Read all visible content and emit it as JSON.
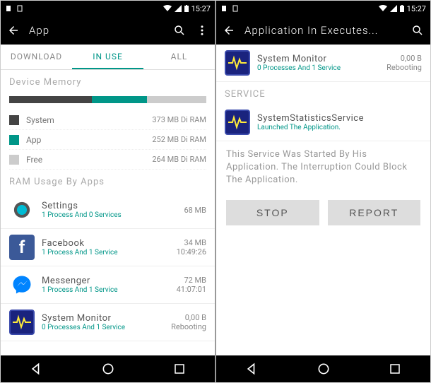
{
  "status": {
    "time": "15:27"
  },
  "left": {
    "title": "App",
    "tabs": {
      "download": "DOWNLOAD",
      "inuse": "IN USE",
      "all": "ALL"
    },
    "sections": {
      "memory": "Device Memory",
      "ramUsage": "RAM Usage By Apps"
    },
    "legend": {
      "system": {
        "label": "System",
        "value": "373 MB Di RAM"
      },
      "app": {
        "label": "App",
        "value": "252 MB Di RAM"
      },
      "free": {
        "label": "Free",
        "value": "264 MB Di RAM"
      }
    },
    "apps": {
      "settings": {
        "name": "Settings",
        "sub": "1 Process And 0 Services",
        "size": "68 MB",
        "time": ""
      },
      "facebook": {
        "name": "Facebook",
        "sub": "1 Process And 1 Service",
        "size": "34 MB",
        "time": "10:49:26"
      },
      "messenger": {
        "name": "Messenger",
        "sub": "1 Process And 1 Service",
        "size": "72 MB",
        "time": "41:07:01"
      },
      "sysmon": {
        "name": "System Monitor",
        "sub": "0 Processes And 1 Service",
        "size": "0,00 B",
        "time": "Rebooting"
      }
    }
  },
  "right": {
    "title": "Application In Executes...",
    "app": {
      "name": "System Monitor",
      "sub": "0 Processes And 1 Service",
      "size": "0,00 B",
      "status": "Rebooting"
    },
    "serviceHeader": "SERVICE",
    "service": {
      "name": "SystemStatisticsService",
      "sub": "Launched The Application."
    },
    "desc": "This Service Was Started By His Application. The Interruption Could Block The Application.",
    "buttons": {
      "stop": "STOP",
      "report": "REPORT"
    }
  },
  "colors": {
    "accent": "#009688",
    "sys": "#444",
    "free": "#ccc"
  }
}
